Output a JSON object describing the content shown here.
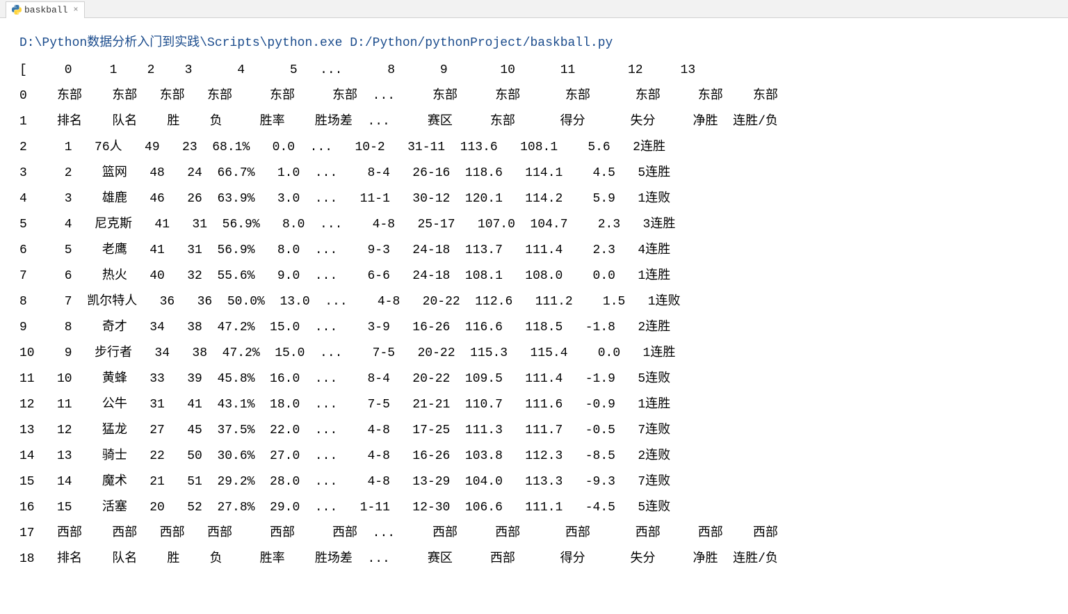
{
  "tab": {
    "label": "baskball",
    "close": "×"
  },
  "command": "D:\\Python数据分析入门到实践\\Scripts\\python.exe D:/Python/pythonProject/baskball.py",
  "lines": [
    "[     0     1    2    3      4      5   ...      8      9       10      11       12     13",
    "0    东部    东部   东部   东部     东部     东部  ...     东部     东部      东部      东部     东部    东部",
    "1    排名    队名    胜    负     胜率    胜场差  ...     赛区     东部      得分      失分     净胜  连胜/负",
    "2     1   76人   49   23  68.1%   0.0  ...   10-2   31-11  113.6   108.1    5.6   2连胜",
    "3     2    篮网   48   24  66.7%   1.0  ...    8-4   26-16  118.6   114.1    4.5   5连胜",
    "4     3    雄鹿   46   26  63.9%   3.0  ...   11-1   30-12  120.1   114.2    5.9   1连败",
    "5     4   尼克斯   41   31  56.9%   8.0  ...    4-8   25-17   107.0  104.7    2.3   3连胜",
    "6     5    老鹰   41   31  56.9%   8.0  ...    9-3   24-18  113.7   111.4    2.3   4连胜",
    "7     6    热火   40   32  55.6%   9.0  ...    6-6   24-18  108.1   108.0    0.0   1连胜",
    "8     7  凯尔特人   36   36  50.0%  13.0  ...    4-8   20-22  112.6   111.2    1.5   1连败",
    "9     8    奇才   34   38  47.2%  15.0  ...    3-9   16-26  116.6   118.5   -1.8   2连胜",
    "10    9   步行者   34   38  47.2%  15.0  ...    7-5   20-22  115.3   115.4    0.0   1连胜",
    "11   10    黄蜂   33   39  45.8%  16.0  ...    8-4   20-22  109.5   111.4   -1.9   5连败",
    "12   11    公牛   31   41  43.1%  18.0  ...    7-5   21-21  110.7   111.6   -0.9   1连胜",
    "13   12    猛龙   27   45  37.5%  22.0  ...    4-8   17-25  111.3   111.7   -0.5   7连败",
    "14   13    骑士   22   50  30.6%  27.0  ...    4-8   16-26  103.8   112.3   -8.5   2连败",
    "15   14    魔术   21   51  29.2%  28.0  ...    4-8   13-29  104.0   113.3   -9.3   7连败",
    "16   15    活塞   20   52  27.8%  29.0  ...   1-11   12-30  106.6   111.1   -4.5   5连败",
    "17   西部    西部   西部   西部     西部     西部  ...     西部     西部      西部      西部     西部    西部",
    "18   排名    队名    胜    负     胜率    胜场差  ...     赛区     西部      得分      失分     净胜  连胜/负"
  ],
  "chart_data": {
    "type": "table",
    "title": "NBA 东部排名",
    "columns_indices": [
      0,
      1,
      2,
      3,
      4,
      5,
      8,
      9,
      10,
      11,
      12,
      13
    ],
    "header_row0": [
      "东部",
      "东部",
      "东部",
      "东部",
      "东部",
      "东部",
      "东部",
      "东部",
      "东部",
      "东部",
      "东部",
      "东部"
    ],
    "header_row1": [
      "排名",
      "队名",
      "胜",
      "负",
      "胜率",
      "胜场差",
      "赛区",
      "东部",
      "得分",
      "失分",
      "净胜",
      "连胜/负"
    ],
    "rows": [
      {
        "排名": 1,
        "队名": "76人",
        "胜": 49,
        "负": 23,
        "胜率": "68.1%",
        "胜场差": 0.0,
        "赛区": "10-2",
        "东部": "31-11",
        "得分": 113.6,
        "失分": 108.1,
        "净胜": 5.6,
        "连胜/负": "2连胜"
      },
      {
        "排名": 2,
        "队名": "篮网",
        "胜": 48,
        "负": 24,
        "胜率": "66.7%",
        "胜场差": 1.0,
        "赛区": "8-4",
        "东部": "26-16",
        "得分": 118.6,
        "失分": 114.1,
        "净胜": 4.5,
        "连胜/负": "5连胜"
      },
      {
        "排名": 3,
        "队名": "雄鹿",
        "胜": 46,
        "负": 26,
        "胜率": "63.9%",
        "胜场差": 3.0,
        "赛区": "11-1",
        "东部": "30-12",
        "得分": 120.1,
        "失分": 114.2,
        "净胜": 5.9,
        "连胜/负": "1连败"
      },
      {
        "排名": 4,
        "队名": "尼克斯",
        "胜": 41,
        "负": 31,
        "胜率": "56.9%",
        "胜场差": 8.0,
        "赛区": "4-8",
        "东部": "25-17",
        "得分": 107.0,
        "失分": 104.7,
        "净胜": 2.3,
        "连胜/负": "3连胜"
      },
      {
        "排名": 5,
        "队名": "老鹰",
        "胜": 41,
        "负": 31,
        "胜率": "56.9%",
        "胜场差": 8.0,
        "赛区": "9-3",
        "东部": "24-18",
        "得分": 113.7,
        "失分": 111.4,
        "净胜": 2.3,
        "连胜/负": "4连胜"
      },
      {
        "排名": 6,
        "队名": "热火",
        "胜": 40,
        "负": 32,
        "胜率": "55.6%",
        "胜场差": 9.0,
        "赛区": "6-6",
        "东部": "24-18",
        "得分": 108.1,
        "失分": 108.0,
        "净胜": 0.0,
        "连胜/负": "1连胜"
      },
      {
        "排名": 7,
        "队名": "凯尔特人",
        "胜": 36,
        "负": 36,
        "胜率": "50.0%",
        "胜场差": 13.0,
        "赛区": "4-8",
        "东部": "20-22",
        "得分": 112.6,
        "失分": 111.2,
        "净胜": 1.5,
        "连胜/负": "1连败"
      },
      {
        "排名": 8,
        "队名": "奇才",
        "胜": 34,
        "负": 38,
        "胜率": "47.2%",
        "胜场差": 15.0,
        "赛区": "3-9",
        "东部": "16-26",
        "得分": 116.6,
        "失分": 118.5,
        "净胜": -1.8,
        "连胜/负": "2连胜"
      },
      {
        "排名": 9,
        "队名": "步行者",
        "胜": 34,
        "负": 38,
        "胜率": "47.2%",
        "胜场差": 15.0,
        "赛区": "7-5",
        "东部": "20-22",
        "得分": 115.3,
        "失分": 115.4,
        "净胜": 0.0,
        "连胜/负": "1连胜"
      },
      {
        "排名": 10,
        "队名": "黄蜂",
        "胜": 33,
        "负": 39,
        "胜率": "45.8%",
        "胜场差": 16.0,
        "赛区": "8-4",
        "东部": "20-22",
        "得分": 109.5,
        "失分": 111.4,
        "净胜": -1.9,
        "连胜/负": "5连败"
      },
      {
        "排名": 11,
        "队名": "公牛",
        "胜": 31,
        "负": 41,
        "胜率": "43.1%",
        "胜场差": 18.0,
        "赛区": "7-5",
        "东部": "21-21",
        "得分": 110.7,
        "失分": 111.6,
        "净胜": -0.9,
        "连胜/负": "1连胜"
      },
      {
        "排名": 12,
        "队名": "猛龙",
        "胜": 27,
        "负": 45,
        "胜率": "37.5%",
        "胜场差": 22.0,
        "赛区": "4-8",
        "东部": "17-25",
        "得分": 111.3,
        "失分": 111.7,
        "净胜": -0.5,
        "连胜/负": "7连败"
      },
      {
        "排名": 13,
        "队名": "骑士",
        "胜": 22,
        "负": 50,
        "胜率": "30.6%",
        "胜场差": 27.0,
        "赛区": "4-8",
        "东部": "16-26",
        "得分": 103.8,
        "失分": 112.3,
        "净胜": -8.5,
        "连胜/负": "2连败"
      },
      {
        "排名": 14,
        "队名": "魔术",
        "胜": 21,
        "负": 51,
        "胜率": "29.2%",
        "胜场差": 28.0,
        "赛区": "4-8",
        "东部": "13-29",
        "得分": 104.0,
        "失分": 113.3,
        "净胜": -9.3,
        "连胜/负": "7连败"
      },
      {
        "排名": 15,
        "队名": "活塞",
        "胜": 20,
        "负": 52,
        "胜率": "27.8%",
        "胜场差": 29.0,
        "赛区": "1-11",
        "东部": "12-30",
        "得分": 106.6,
        "失分": 111.1,
        "净胜": -4.5,
        "连胜/负": "5连败"
      }
    ],
    "west_header_row17": [
      "西部",
      "西部",
      "西部",
      "西部",
      "西部",
      "西部",
      "西部",
      "西部",
      "西部",
      "西部",
      "西部",
      "西部"
    ],
    "west_header_row18": [
      "排名",
      "队名",
      "胜",
      "负",
      "胜率",
      "胜场差",
      "赛区",
      "西部",
      "得分",
      "失分",
      "净胜",
      "连胜/负"
    ]
  }
}
